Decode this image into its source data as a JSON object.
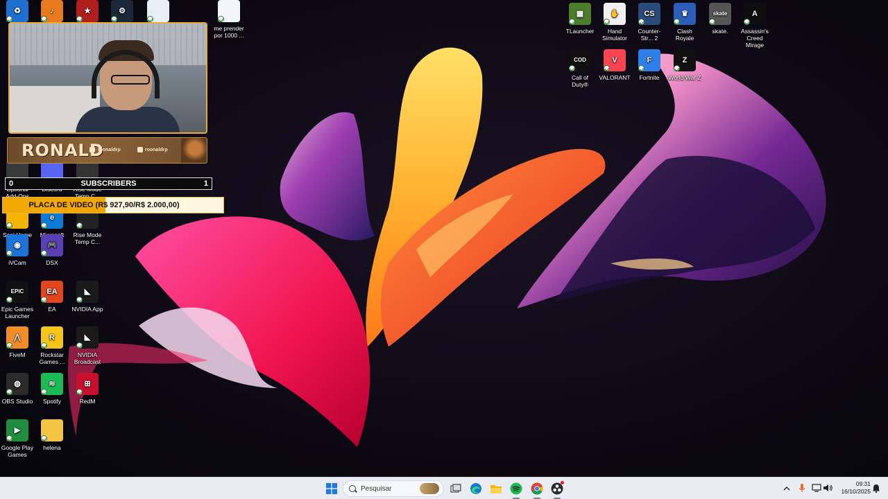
{
  "desktop_left": [
    {
      "label": "",
      "color": "#1f6fd1",
      "glyph": "♻",
      "icon": "recycle-bin-icon"
    },
    {
      "label": "",
      "color": "#e87a1d",
      "glyph": "♪",
      "icon": "fl-studio-icon"
    },
    {
      "label": "",
      "color": "#b01e1e",
      "glyph": "★",
      "icon": "rdr-icon"
    },
    {
      "label": "",
      "color": "#1b2838",
      "glyph": "⚙",
      "icon": "steam-icon"
    },
    {
      "label": "",
      "color": "#e8eef5",
      "glyph": "",
      "icon": "document-icon"
    },
    {
      "label": "me prender por 1000 ...",
      "color": "#f2f5f9",
      "glyph": "",
      "icon": "document-icon"
    },
    {
      "label": "Optional Add-Ons",
      "color": "#3a3a3a",
      "glyph": "",
      "icon": "app-icon"
    },
    {
      "label": "Discord",
      "color": "#5865f2",
      "glyph": "",
      "icon": "discord-icon"
    },
    {
      "label": "Rise Mode Temp C...",
      "color": "#333",
      "glyph": "",
      "icon": "rise-mode-icon"
    },
    {
      "label": "Seni Home",
      "color": "#f4b400",
      "glyph": "",
      "icon": "folder-icon"
    },
    {
      "label": "Microsoft Edge",
      "color": "#0c7bd6",
      "glyph": "e",
      "icon": "edge-icon"
    },
    {
      "label": "Rise Mode Temp C...",
      "color": "#222",
      "glyph": "",
      "icon": "rise-mode-icon"
    },
    {
      "label": "iVCam",
      "color": "#1d74d8",
      "glyph": "◉",
      "icon": "ivcam-icon"
    },
    {
      "label": "DSX",
      "color": "#5b3fb5",
      "glyph": "🎮",
      "icon": "dsx-icon"
    },
    {
      "label": "Epic Games Launcher",
      "color": "#111",
      "glyph": "EPIC",
      "icon": "epic-games-icon"
    },
    {
      "label": "EA",
      "color": "#e2461f",
      "glyph": "EA",
      "icon": "ea-icon"
    },
    {
      "label": "NVIDIA App",
      "color": "#1a1a1a",
      "glyph": "◣",
      "icon": "nvidia-icon"
    },
    {
      "label": "FiveM",
      "color": "#f28c28",
      "glyph": "⋀",
      "icon": "fivem-icon"
    },
    {
      "label": "Rockstar Games ...",
      "color": "#f5c518",
      "glyph": "R",
      "icon": "rockstar-icon"
    },
    {
      "label": "NVIDIA Broadcast",
      "color": "#1a1a1a",
      "glyph": "◣",
      "icon": "nvidia-broadcast-icon"
    },
    {
      "label": "OBS Studio",
      "color": "#2b2b2b",
      "glyph": "◍",
      "icon": "obs-icon"
    },
    {
      "label": "Spotify",
      "color": "#1db954",
      "glyph": "≋",
      "icon": "spotify-icon"
    },
    {
      "label": "RedM",
      "color": "#c8102e",
      "glyph": "⊞",
      "icon": "redm-icon"
    },
    {
      "label": "Google Play Games",
      "color": "#1e8e3e",
      "glyph": "▶",
      "icon": "google-play-games-icon"
    },
    {
      "label": "helena",
      "color": "#f4c542",
      "glyph": "",
      "icon": "folder-icon"
    }
  ],
  "desktop_right": [
    {
      "label": "TLauncher",
      "color": "#4c7d2a",
      "glyph": "▦",
      "icon": "tlauncher-icon"
    },
    {
      "label": "Hand Simulator",
      "color": "#f1f1f1",
      "glyph": "✋",
      "icon": "hand-simulator-icon"
    },
    {
      "label": "Counter-Str... 2",
      "color": "#2a4a7a",
      "glyph": "CS",
      "icon": "counter-strike-icon"
    },
    {
      "label": "Clash Royale",
      "color": "#2c5db8",
      "glyph": "♛",
      "icon": "clash-royale-icon"
    },
    {
      "label": "skate.",
      "color": "#555",
      "glyph": "skate",
      "icon": "skate-icon"
    },
    {
      "label": "Assassin's Creed Mirage",
      "color": "#0e0e0e",
      "glyph": "A",
      "icon": "assassins-creed-icon"
    },
    {
      "label": "Call of Duty®",
      "color": "#111",
      "glyph": "COD",
      "icon": "call-of-duty-icon"
    },
    {
      "label": "VALORANT",
      "color": "#fa4454",
      "glyph": "V",
      "icon": "valorant-icon"
    },
    {
      "label": "Fortnite",
      "color": "#2f7fe8",
      "glyph": "F",
      "icon": "fortnite-icon"
    },
    {
      "label": "World War Z",
      "color": "#111",
      "glyph": "Z",
      "icon": "world-war-z-icon"
    }
  ],
  "overlay": {
    "streamer_name": "RONALD",
    "handle_1": "roonaldrp",
    "handle_2": "roonaldrp",
    "subs_label": "SUBSCRIBERS",
    "subs_current": "0",
    "subs_goal": "1",
    "subs_progress": 0.0,
    "goal_label": "PLACA DE VIDEO (R$ 927,90/R$ 2.000,00)",
    "goal_progress": 0.464
  },
  "taskbar": {
    "search_placeholder": "Pesquisar",
    "time": "09:31",
    "date": "16/10/2025",
    "apps": [
      "windows-start-icon",
      "task-view-icon",
      "edge-icon",
      "file-explorer-icon",
      "spotify-icon",
      "chrome-icon",
      "obs-icon"
    ]
  }
}
